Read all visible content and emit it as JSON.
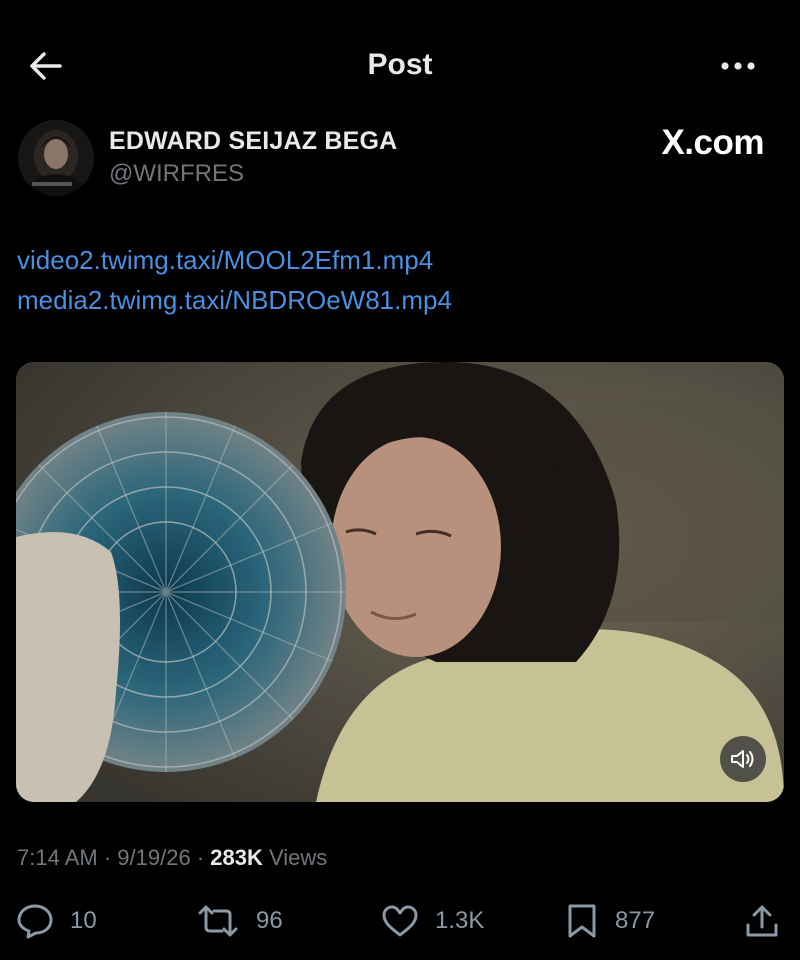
{
  "header": {
    "title": "Post",
    "back_icon": "arrow-left-icon",
    "more_icon": "more-horizontal-icon"
  },
  "author": {
    "display_name": "EDWARD SEIJAZ BEGA",
    "handle": "@WIRFRES",
    "brand": "X.com"
  },
  "links": [
    "video2.twimg.taxi/MOOL2Efm1.mp4",
    "media2.twimg.taxi/NBDROeW81.mp4"
  ],
  "media": {
    "mute_icon": "speaker-icon"
  },
  "meta": {
    "time": "7:14 AM",
    "sep1": "·",
    "date": "9/19/26",
    "sep2": "·",
    "views_count": "283K",
    "views_label": "Views"
  },
  "actions": {
    "replies": "10",
    "reposts": "96",
    "likes": "1.3K",
    "bookmarks": "877"
  },
  "colors": {
    "background": "#000000",
    "link": "#4a90e2",
    "secondary_text": "#71767b",
    "primary_text": "#e7e9ea"
  }
}
